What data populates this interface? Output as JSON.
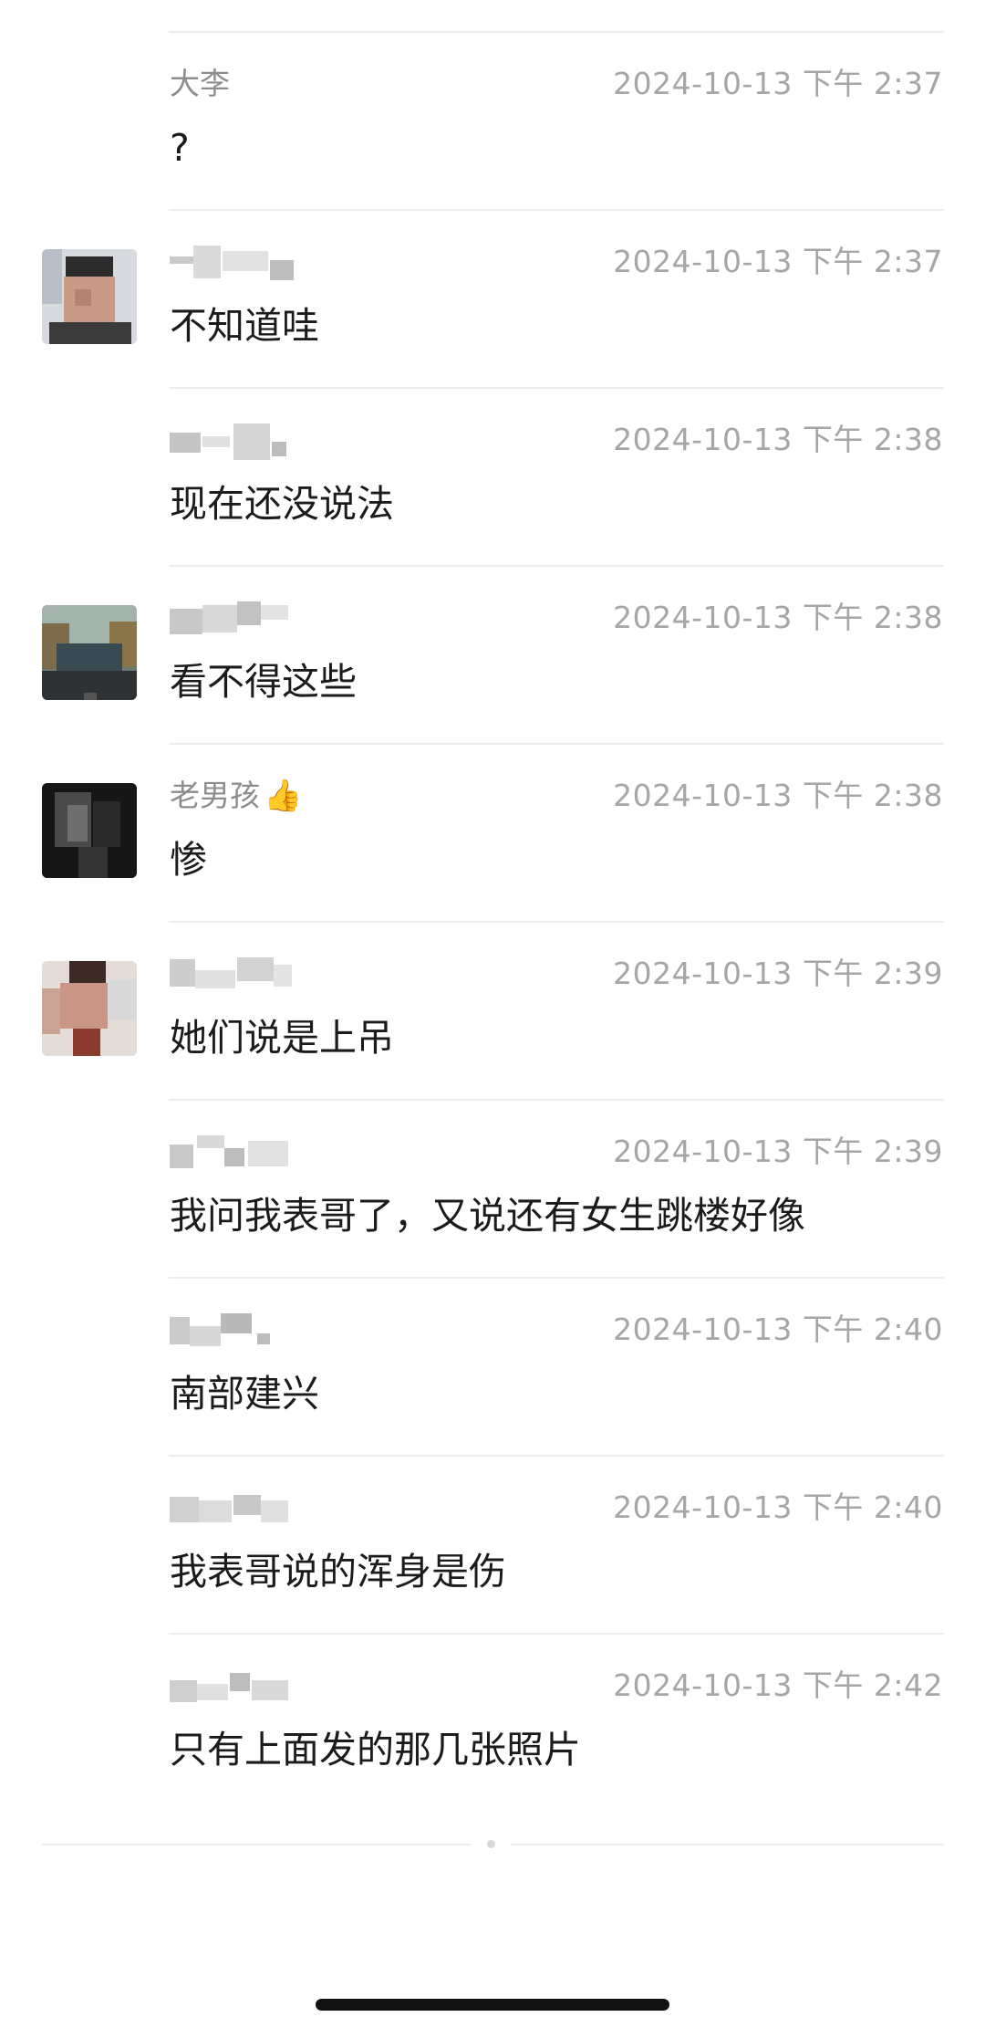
{
  "messages": [
    {
      "sender": "大李",
      "time": "2024-10-13 下午 2:37",
      "text": "?",
      "avatar": false
    },
    {
      "sender": "",
      "time": "2024-10-13 下午 2:37",
      "text": "不知道哇",
      "avatar": true
    },
    {
      "sender": "",
      "time": "2024-10-13 下午 2:38",
      "text": "现在还没说法",
      "avatar": false
    },
    {
      "sender": "",
      "time": "2024-10-13 下午 2:38",
      "text": "看不得这些",
      "avatar": true
    },
    {
      "sender": "老男孩",
      "sender_emoji": "👍",
      "time": "2024-10-13 下午 2:38",
      "text": "惨",
      "avatar": true
    },
    {
      "sender": "",
      "time": "2024-10-13 下午 2:39",
      "text": "她们说是上吊",
      "avatar": true
    },
    {
      "sender": "",
      "time": "2024-10-13 下午 2:39",
      "text": "我问我表哥了，又说还有女生跳楼好像",
      "avatar": false
    },
    {
      "sender": "",
      "time": "2024-10-13 下午 2:40",
      "text": "南部建兴",
      "avatar": false
    },
    {
      "sender": "",
      "time": "2024-10-13 下午 2:40",
      "text": "我表哥说的浑身是伤",
      "avatar": false
    },
    {
      "sender": "",
      "time": "2024-10-13 下午 2:42",
      "text": "只有上面发的那几张照片",
      "avatar": false
    }
  ],
  "colors": {
    "sender": "#8d8d8d",
    "timestamp": "#a6a6a6",
    "message_text": "#1b1b1b",
    "separator": "#ececec",
    "background": "#ffffff"
  }
}
